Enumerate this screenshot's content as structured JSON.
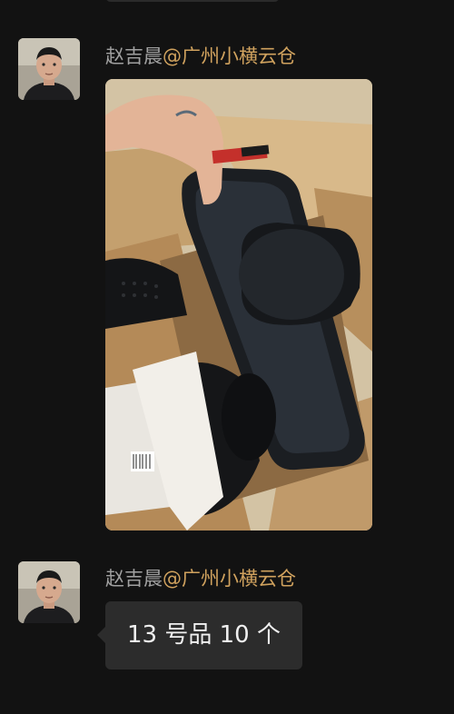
{
  "colors": {
    "background": "#121212",
    "sender_name": "#a0a0a0",
    "sender_org": "#d0a25e",
    "bubble": "#2c2c2c",
    "bubble_text": "#f0f0f0"
  },
  "messages": [
    {
      "sender_name": "赵吉晨",
      "sender_org": "@广州小横云仓",
      "type": "image",
      "image_desc_icon": "photo-icon"
    },
    {
      "sender_name": "赵吉晨",
      "sender_org": "@广州小横云仓",
      "type": "text",
      "text": "13 号品 10 个"
    }
  ]
}
